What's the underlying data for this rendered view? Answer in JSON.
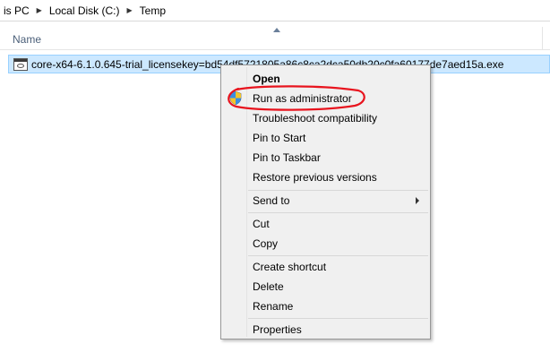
{
  "breadcrumb": {
    "items": [
      "is PC",
      "Local Disk (C:)",
      "Temp"
    ]
  },
  "file_list": {
    "column_name": "Name",
    "selected_file": "core-x64-6.1.0.645-trial_licensekey=bd54df5721805a86c8ca2dca50db20c0fa60177de7aed15a.exe"
  },
  "context_menu": {
    "items": {
      "open": "Open",
      "run_as_admin": "Run as administrator",
      "troubleshoot": "Troubleshoot compatibility",
      "pin_start": "Pin to Start",
      "pin_taskbar": "Pin to Taskbar",
      "restore": "Restore previous versions",
      "send_to": "Send to",
      "cut": "Cut",
      "copy": "Copy",
      "create_shortcut": "Create shortcut",
      "delete": "Delete",
      "rename": "Rename",
      "properties": "Properties"
    }
  },
  "colors": {
    "selection_bg": "#cce8ff",
    "selection_border": "#99d1ff",
    "menu_bg": "#f0f0f0",
    "annotation_red": "#e8141e"
  },
  "icons": {
    "file": "exe-file-icon",
    "admin": "uac-shield-icon",
    "submenu": "chevron-right-icon"
  }
}
